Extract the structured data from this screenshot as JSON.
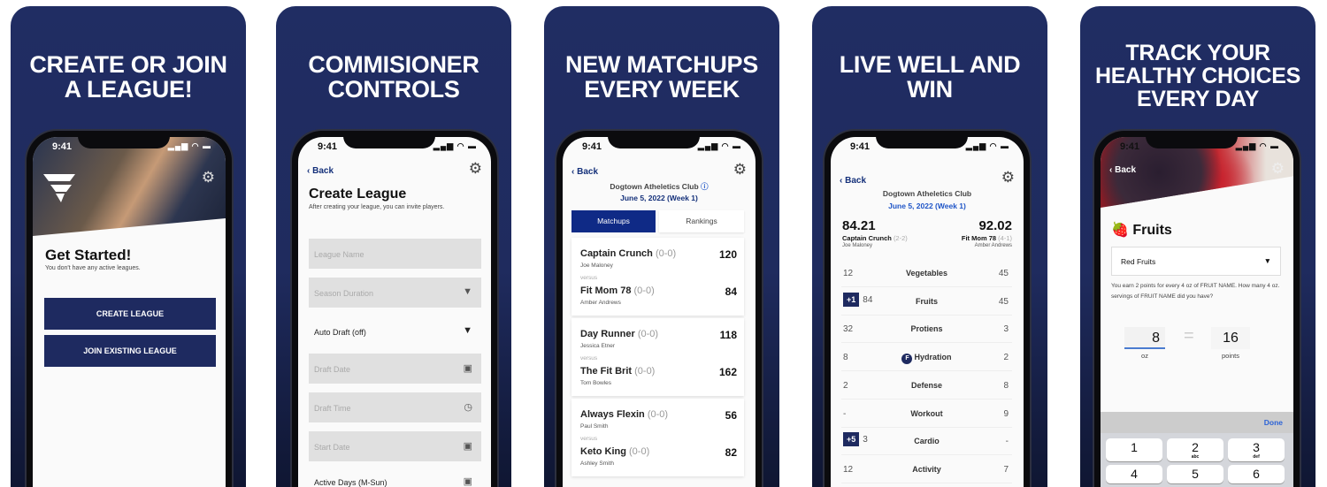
{
  "colors": {
    "brand_navy": "#1e2a60",
    "link_blue": "#1f55c7",
    "background": "#202d63"
  },
  "status_time": "9:41",
  "status_icons": "signal wifi battery",
  "panel1": {
    "headline": [
      "CREATE OR JOIN",
      "A LEAGUE!"
    ],
    "title": "Get Started!",
    "subtitle": "You don't have any active leagues.",
    "create_button": "CREATE LEAGUE",
    "join_button": "JOIN EXISTING LEAGUE"
  },
  "panel2": {
    "headline": [
      "COMMISIONER",
      "CONTROLS"
    ],
    "back": "Back",
    "title": "Create League",
    "subtitle": "After creating your league, you can invite players.",
    "fields": [
      {
        "placeholder": "League Name",
        "icon": ""
      },
      {
        "placeholder": "Season Duration",
        "icon": "dropdown"
      },
      {
        "value": "Auto Draft (off)",
        "icon": "dropdown"
      },
      {
        "placeholder": "Draft Date",
        "icon": "calendar"
      },
      {
        "placeholder": "Draft Time",
        "icon": "clock"
      },
      {
        "placeholder": "Start Date",
        "icon": "calendar"
      },
      {
        "value": "Active Days (M-Sun)",
        "icon": "calendar"
      }
    ]
  },
  "panel3": {
    "headline": [
      "NEW MATCHUPS",
      "EVERY WEEK"
    ],
    "back": "Back",
    "club": "Dogtown Atheletics Club",
    "date": "June 5, 2022 (Week 1)",
    "tabs": [
      "Matchups",
      "Rankings"
    ],
    "versus": "versus",
    "matchups": [
      {
        "a": {
          "team": "Captain Crunch",
          "record": "(0-0)",
          "owner": "Joe Maloney",
          "score": "120"
        },
        "b": {
          "team": "Fit Mom 78",
          "record": "(0-0)",
          "owner": "Amber Andrews",
          "score": "84"
        }
      },
      {
        "a": {
          "team": "Day Runner",
          "record": "(0-0)",
          "owner": "Jessica Etner",
          "score": "118"
        },
        "b": {
          "team": "The Fit Brit",
          "record": "(0-0)",
          "owner": "Tom Bowles",
          "score": "162"
        }
      },
      {
        "a": {
          "team": "Always Flexin",
          "record": "(0-0)",
          "owner": "Paul Smith",
          "score": "56"
        },
        "b": {
          "team": "Keto King",
          "record": "(0-0)",
          "owner": "Ashley Smith",
          "score": "82"
        }
      }
    ]
  },
  "panel4": {
    "headline": [
      "LIVE WELL AND",
      "WIN"
    ],
    "back": "Back",
    "club": "Dogtown Atheletics Club",
    "date": "June 5, 2022 (Week 1)",
    "left": {
      "score": "84.21",
      "team": "Captain Crunch",
      "record": "(2-2)",
      "owner": "Joe Maloney"
    },
    "right": {
      "score": "92.02",
      "team": "Fit Mom 78",
      "record": "(4-1)",
      "owner": "Amber Andrews"
    },
    "rows": [
      {
        "l": "12",
        "c": "Vegetables",
        "r": "45",
        "bonus": ""
      },
      {
        "l": "84",
        "c": "Fruits",
        "r": "45",
        "bonus": "+1"
      },
      {
        "l": "32",
        "c": "Protiens",
        "r": "3",
        "bonus": ""
      },
      {
        "l": "8",
        "c": "Hydration",
        "r": "2",
        "bonus": ""
      },
      {
        "l": "2",
        "c": "Defense",
        "r": "8",
        "bonus": ""
      },
      {
        "l": "-",
        "c": "Workout",
        "r": "9",
        "bonus": ""
      },
      {
        "l": "3",
        "c": "Cardio",
        "r": "-",
        "bonus": "+5"
      },
      {
        "l": "12",
        "c": "Activity",
        "r": "7",
        "bonus": ""
      }
    ]
  },
  "panel5": {
    "headline": [
      "TRACK YOUR",
      "HEALTHY CHOICES",
      "EVERY DAY"
    ],
    "back": "Back",
    "title": "Fruits",
    "dropdown": "Red Fruits",
    "help": "You earn 2 points for every 4 oz of FRUIT NAME. How many 4 oz. servings of FRUIT NAME did you have?",
    "oz_value": "8",
    "oz_label": "oz",
    "equals": "=",
    "points_value": "16",
    "points_label": "points",
    "done": "Done",
    "keys": [
      {
        "n": "1",
        "s": ""
      },
      {
        "n": "2",
        "s": "abc"
      },
      {
        "n": "3",
        "s": "def"
      },
      {
        "n": "4",
        "s": ""
      },
      {
        "n": "5",
        "s": ""
      },
      {
        "n": "6",
        "s": ""
      }
    ]
  }
}
